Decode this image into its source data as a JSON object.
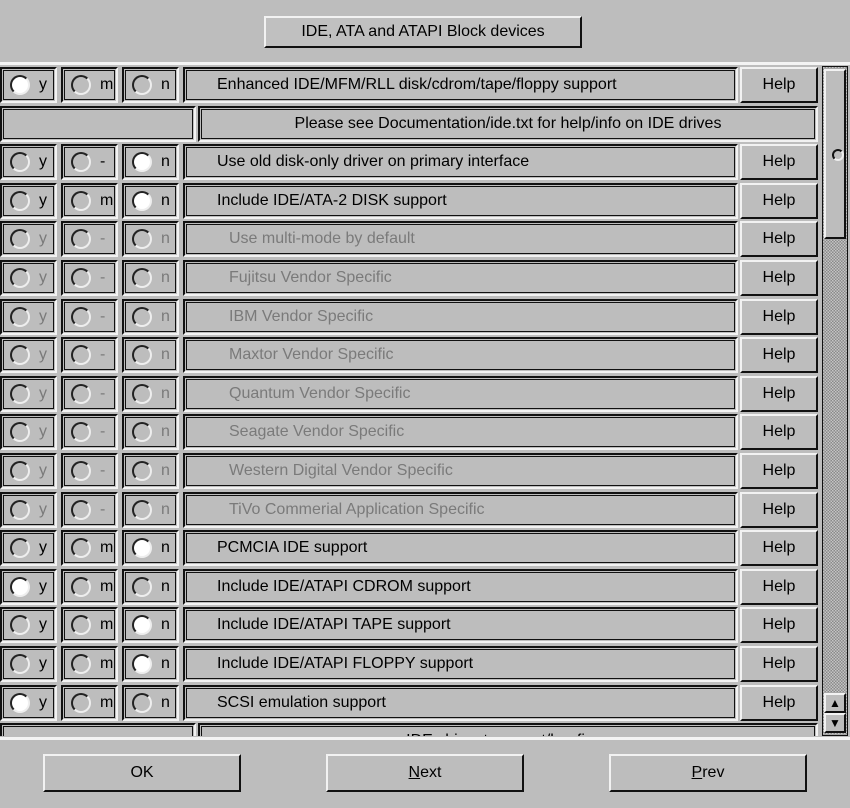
{
  "title": "IDE, ATA and ATAPI Block devices",
  "help_label": "Help",
  "rows": [
    {
      "type": "option",
      "labels": [
        "y",
        "m",
        "n"
      ],
      "selected": "y",
      "prompt": "Enhanced IDE/MFM/RLL disk/cdrom/tape/floppy support",
      "disabled": false,
      "indent": false
    },
    {
      "type": "comment",
      "text": "Please see Documentation/ide.txt for help/info on IDE drives"
    },
    {
      "type": "option",
      "labels": [
        "y",
        "-",
        "n"
      ],
      "selected": "n",
      "prompt": "Use old disk-only driver on primary interface",
      "disabled": false,
      "indent": false
    },
    {
      "type": "option",
      "labels": [
        "y",
        "m",
        "n"
      ],
      "selected": "n",
      "prompt": "Include IDE/ATA-2 DISK support",
      "disabled": false,
      "indent": false
    },
    {
      "type": "option",
      "labels": [
        "y",
        "-",
        "n"
      ],
      "selected": "",
      "prompt": "Use multi-mode by default",
      "disabled": true,
      "indent": true
    },
    {
      "type": "option",
      "labels": [
        "y",
        "-",
        "n"
      ],
      "selected": "",
      "prompt": "Fujitsu Vendor Specific",
      "disabled": true,
      "indent": true
    },
    {
      "type": "option",
      "labels": [
        "y",
        "-",
        "n"
      ],
      "selected": "",
      "prompt": "IBM Vendor Specific",
      "disabled": true,
      "indent": true
    },
    {
      "type": "option",
      "labels": [
        "y",
        "-",
        "n"
      ],
      "selected": "",
      "prompt": "Maxtor Vendor Specific",
      "disabled": true,
      "indent": true
    },
    {
      "type": "option",
      "labels": [
        "y",
        "-",
        "n"
      ],
      "selected": "",
      "prompt": "Quantum Vendor Specific",
      "disabled": true,
      "indent": true
    },
    {
      "type": "option",
      "labels": [
        "y",
        "-",
        "n"
      ],
      "selected": "",
      "prompt": "Seagate Vendor Specific",
      "disabled": true,
      "indent": true
    },
    {
      "type": "option",
      "labels": [
        "y",
        "-",
        "n"
      ],
      "selected": "",
      "prompt": "Western Digital Vendor Specific",
      "disabled": true,
      "indent": true
    },
    {
      "type": "option",
      "labels": [
        "y",
        "-",
        "n"
      ],
      "selected": "",
      "prompt": "TiVo Commerial Application Specific",
      "disabled": true,
      "indent": true
    },
    {
      "type": "option",
      "labels": [
        "y",
        "m",
        "n"
      ],
      "selected": "n",
      "prompt": "PCMCIA IDE support",
      "disabled": false,
      "indent": false
    },
    {
      "type": "option",
      "labels": [
        "y",
        "m",
        "n"
      ],
      "selected": "y",
      "prompt": "Include IDE/ATAPI CDROM support",
      "disabled": false,
      "indent": false
    },
    {
      "type": "option",
      "labels": [
        "y",
        "m",
        "n"
      ],
      "selected": "n",
      "prompt": "Include IDE/ATAPI TAPE support",
      "disabled": false,
      "indent": false
    },
    {
      "type": "option",
      "labels": [
        "y",
        "m",
        "n"
      ],
      "selected": "n",
      "prompt": "Include IDE/ATAPI FLOPPY support",
      "disabled": false,
      "indent": false
    },
    {
      "type": "option",
      "labels": [
        "y",
        "m",
        "n"
      ],
      "selected": "y",
      "prompt": "SCSI emulation support",
      "disabled": false,
      "indent": false
    },
    {
      "type": "comment",
      "text": "IDE chipset support/bugfixes"
    }
  ],
  "scrollbar": {
    "up_icon": "▲",
    "down_icon": "▼",
    "position_fraction": 0.0
  },
  "buttons": {
    "ok": "OK",
    "next": "Next",
    "prev": "Prev"
  }
}
